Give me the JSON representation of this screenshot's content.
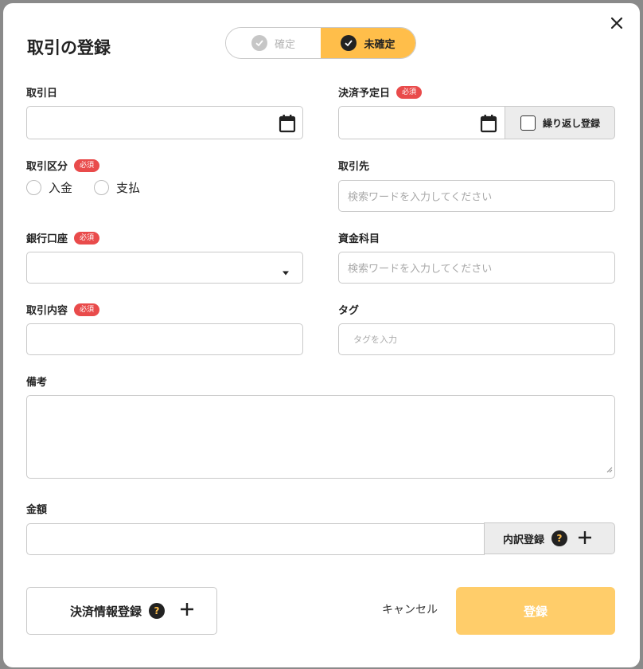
{
  "modal": {
    "title": "取引の登録",
    "status_toggle": {
      "confirmed_label": "確定",
      "unconfirmed_label": "未確定",
      "selected": "未確定",
      "accent_color": "#ffbe4a"
    }
  },
  "form": {
    "transaction_date": {
      "label": "取引日",
      "value": ""
    },
    "settlement_date": {
      "label": "決済予定日",
      "required_badge": "必須",
      "value": ""
    },
    "repeat_register": {
      "label": "繰り返し登録",
      "checked": false
    },
    "transaction_type": {
      "label": "取引区分",
      "required_badge": "必須",
      "options": [
        "入金",
        "支払"
      ],
      "selected": null
    },
    "counterparty": {
      "label": "取引先",
      "placeholder": "検索ワードを入力してください"
    },
    "bank_account": {
      "label": "銀行口座",
      "required_badge": "必須",
      "value": ""
    },
    "fund_category": {
      "label": "資金科目",
      "placeholder": "検索ワードを入力してください"
    },
    "description": {
      "label": "取引内容",
      "required_badge": "必須",
      "value": ""
    },
    "tags": {
      "label": "タグ",
      "placeholder": "タグを入力"
    },
    "notes": {
      "label": "備考",
      "value": ""
    },
    "amount": {
      "label": "金額",
      "value": ""
    },
    "breakdown_button": {
      "label": "内訳登録"
    }
  },
  "footer": {
    "settlement_info_button": "決済情報登録",
    "cancel_label": "キャンセル",
    "submit_label": "登録",
    "help_glyph": "?"
  },
  "colors": {
    "required_badge": "#e94b4b",
    "submit_disabled": "#ffcd6a"
  }
}
